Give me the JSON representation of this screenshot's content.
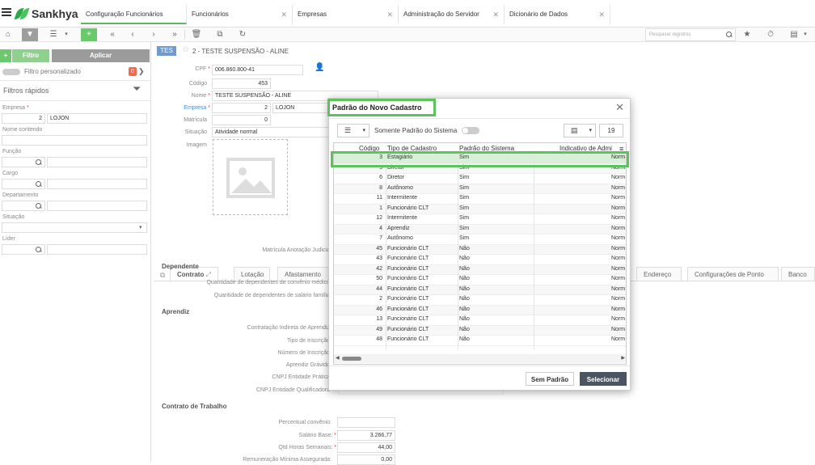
{
  "app": {
    "name": "Sankhya"
  },
  "tabs": [
    {
      "label": "Configuração Funcionários"
    },
    {
      "label": "Funcionários"
    },
    {
      "label": "Empresas"
    },
    {
      "label": "Administração do Servidor"
    },
    {
      "label": "Dicionário de Dados"
    }
  ],
  "toolbar": {
    "search_placeholder": "Pesquisar registros"
  },
  "left": {
    "filtro_label": "Filtro",
    "aplicar_label": "Aplicar",
    "filtro_personalizado": "Filtro personalizado",
    "filtro_count": "0",
    "filtros_rapidos": "Filtros rápidos",
    "empresa_label": "Empresa",
    "empresa_code": "2",
    "empresa_name": "LOJON",
    "nome_contendo": "Nome contendo",
    "funcao": "Função",
    "cargo": "Cargo",
    "departamento": "Departamento",
    "situacao": "Situação",
    "lider": "Líder"
  },
  "record": {
    "badge": "TES",
    "title": "2 - TESTE SUSPENSÃO - ALINE",
    "cpf_label": "CPF",
    "cpf": "006.860.800-41",
    "codigo_label": "Código",
    "codigo": "453",
    "nome_label": "Nome",
    "nome": "TESTE SUSPENSÃO - ALINE",
    "empresa_label": "Empresa",
    "empresa_code": "2",
    "empresa_name": "LOJON",
    "matricula_label": "Matrícula",
    "matricula": "0",
    "situacao_label": "Situação",
    "situacao": "Atividade normal",
    "imagem_label": "Imagem"
  },
  "main_tabs": [
    {
      "label": "Contrato"
    },
    {
      "label": "Lotação"
    },
    {
      "label": "Afastamento"
    },
    {
      "label": "Endereço"
    },
    {
      "label": "Configurações de Ponto"
    },
    {
      "label": "Banco"
    }
  ],
  "form": {
    "matricula_anotacao": "Matrícula Anotação Judicia",
    "dependente_section": "Dependente",
    "qtd_dep_convenio": "Quantidade de dependentes de convênio médico",
    "qtd_dep_salario": "Quantidade de dependentes de salário família",
    "aprendiz_section": "Aprendiz",
    "contratacao_indireta": "Contratação Indireta de Aprendiz",
    "tipo_inscricao": "Tipo de Inscrição",
    "numero_inscricao": "Número de Inscrição",
    "aprendiz_gravida": "Aprendiz Grávida",
    "cnpj_pratica": "CNPJ Entidade Prática",
    "cnpj_qualificadora": "CNPJ Entidade Qualificadora",
    "contrato_trabalho_section": "Contrato de Trabalho",
    "percentual_convenio": "Percentual convênio:",
    "salario_base_label": "Salário Base:",
    "salario_base": "3.266,77",
    "qtd_horas_label": "Qtd Horas Semanais:",
    "qtd_horas": "44,00",
    "remuneracao_label": "Remuneração Mínima Assegurada:",
    "remuneracao": "0,00"
  },
  "modal": {
    "title": "Padrão do Novo Cadastro",
    "somente_padrao": "Somente Padrão do Sistema",
    "page_count": "19",
    "columns": [
      "Código",
      "Tipo de Cadastro",
      "Padrão do Sistema",
      "Indicativo de Admi"
    ],
    "rows": [
      {
        "codigo": "3",
        "tipo": "Estagiário",
        "padrao": "Sim",
        "indicativo": "Norm"
      },
      {
        "codigo": "5",
        "tipo": "Diretor",
        "padrao": "Sim",
        "indicativo": "Norm"
      },
      {
        "codigo": "6",
        "tipo": "Diretor",
        "padrao": "Sim",
        "indicativo": "Norm"
      },
      {
        "codigo": "8",
        "tipo": "Autônomo",
        "padrao": "Sim",
        "indicativo": "Norm"
      },
      {
        "codigo": "11",
        "tipo": "Intermitente",
        "padrao": "Sim",
        "indicativo": "Norm"
      },
      {
        "codigo": "1",
        "tipo": "Funcionário CLT",
        "padrao": "Sim",
        "indicativo": "Norm"
      },
      {
        "codigo": "12",
        "tipo": "Intermitente",
        "padrao": "Sim",
        "indicativo": "Norm"
      },
      {
        "codigo": "4",
        "tipo": "Aprendiz",
        "padrao": "Sim",
        "indicativo": "Norm"
      },
      {
        "codigo": "7",
        "tipo": "Autônomo",
        "padrao": "Sim",
        "indicativo": "Norm"
      },
      {
        "codigo": "45",
        "tipo": "Funcionário CLT",
        "padrao": "Não",
        "indicativo": "Norm"
      },
      {
        "codigo": "43",
        "tipo": "Funcionário CLT",
        "padrao": "Não",
        "indicativo": "Norm"
      },
      {
        "codigo": "42",
        "tipo": "Funcionário CLT",
        "padrao": "Não",
        "indicativo": "Norm"
      },
      {
        "codigo": "50",
        "tipo": "Funcionário CLT",
        "padrao": "Não",
        "indicativo": "Norm"
      },
      {
        "codigo": "44",
        "tipo": "Funcionário CLT",
        "padrao": "Não",
        "indicativo": "Norm"
      },
      {
        "codigo": "2",
        "tipo": "Funcionário CLT",
        "padrao": "Não",
        "indicativo": "Norm"
      },
      {
        "codigo": "46",
        "tipo": "Funcionário CLT",
        "padrao": "Não",
        "indicativo": "Norm"
      },
      {
        "codigo": "13",
        "tipo": "Funcionário CLT",
        "padrao": "Não",
        "indicativo": "Norm"
      },
      {
        "codigo": "49",
        "tipo": "Funcionário CLT",
        "padrao": "Não",
        "indicativo": "Norm"
      },
      {
        "codigo": "48",
        "tipo": "Funcionário CLT",
        "padrao": "Não",
        "indicativo": "Norm"
      }
    ],
    "sem_padrao_label": "Sem Padrão",
    "selecionar_label": "Selecionar"
  },
  "colors": {
    "accent": "#5cc35c",
    "primary_button": "#4a5561"
  }
}
